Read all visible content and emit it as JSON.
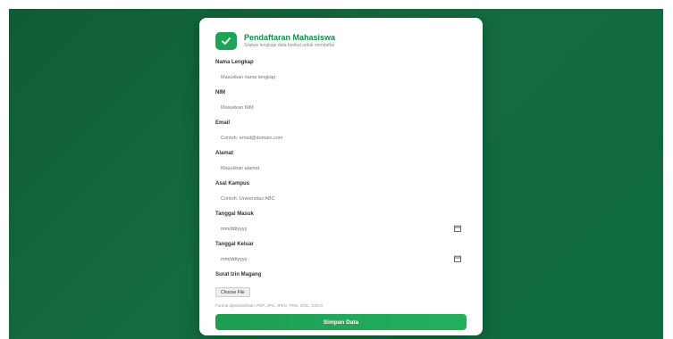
{
  "form": {
    "title": "Pendaftaran Mahasiswa",
    "subtitle": "Silakan lengkapi data berikut untuk mendaftar",
    "fields": [
      {
        "label": "Nama Lengkap",
        "placeholder": "Masukkan nama lengkap"
      },
      {
        "label": "NIM",
        "placeholder": "Masukkan NIM"
      },
      {
        "label": "Email",
        "placeholder": "Contoh: email@domain.com"
      },
      {
        "label": "Alamat",
        "placeholder": "Masukkan alamat"
      },
      {
        "label": "Asal Kampus",
        "placeholder": "Contoh: Universitas ABC"
      },
      {
        "label": "Tanggal Masuk",
        "value": "mm/dd/yyyy"
      },
      {
        "label": "Tanggal Keluar",
        "value": "mm/dd/yyyy"
      }
    ],
    "file": {
      "label": "Surat Izin Magang",
      "button": "Choose File",
      "hint": "Format diperbolehkan: PDF, JPG, JPEG, PNG, DOC, DOCX"
    },
    "submit": "Simpan Data"
  },
  "colors": {
    "accent": "#1fa457",
    "title": "#198a4b",
    "background": "#0f5c36"
  },
  "icons": {
    "logo": "check-icon",
    "date": "calendar-icon"
  }
}
